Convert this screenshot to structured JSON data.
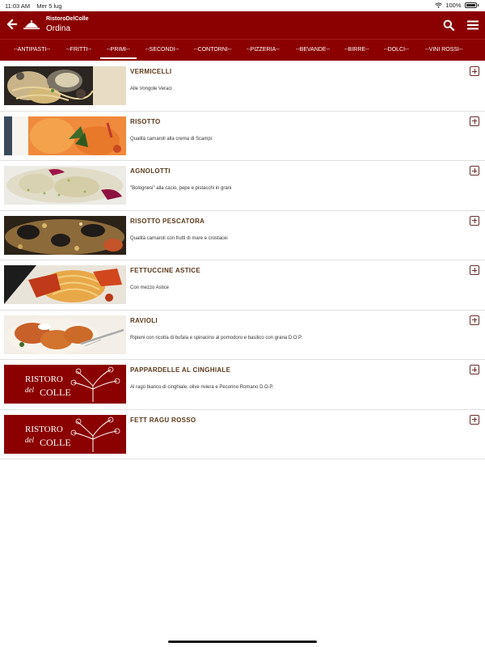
{
  "status": {
    "time": "11:03 AM",
    "date": "Mer 5 lug",
    "battery": "100%"
  },
  "header": {
    "brand": "RistoroDelColle",
    "title": "Ordina"
  },
  "tabs": [
    {
      "label": "--ANTIPASTI--"
    },
    {
      "label": "--FRITTI--"
    },
    {
      "label": "--PRIMI--"
    },
    {
      "label": "--SECONDI--"
    },
    {
      "label": "--CONTORNI--"
    },
    {
      "label": "--PIZZERIA--"
    },
    {
      "label": "--BEVANDE--"
    },
    {
      "label": "--BIRRE--"
    },
    {
      "label": "--DOLCI--"
    },
    {
      "label": "--VINI ROSSI--"
    }
  ],
  "active_tab": "--PRIMI--",
  "items": [
    {
      "name": "VERMICELLI",
      "description": "Alle Vongole Veraci",
      "image": "pasta-clams-photo"
    },
    {
      "name": "RISOTTO",
      "description": "Qualità carnaroli alla crema di Scampi",
      "image": "risotto-photo"
    },
    {
      "name": "AGNOLOTTI",
      "description": "\"Bolognesi\" alla cacio, pepe e pistacchi in grani",
      "image": "agnolotti-photo"
    },
    {
      "name": "RISOTTO PESCATORA",
      "description": "Qualità carnaroli con frutti di mare e crostacei",
      "image": "seafood-risotto-photo"
    },
    {
      "name": "FETTUCCINE ASTICE",
      "description": "Con mezzo Astice",
      "image": "lobster-pasta-photo"
    },
    {
      "name": "RAVIOLI",
      "description": "Ripieni con ricotta di bufala e spinacino al pomodoro e basilico con grana D.O.P.",
      "image": "ravioli-photo"
    },
    {
      "name": "PAPPARDELLE AL CINGHIALE",
      "description": "Al ragù bianco di cinghiale, olive riviera e Pecorino Romano D.O.P.",
      "image": "ristoro-logo"
    },
    {
      "name": "FETT RAGU ROSSO",
      "description": "",
      "image": "ristoro-logo"
    }
  ],
  "logo_text": {
    "line1": "RISTORO",
    "line2": "del",
    "line3": "COLLE"
  },
  "colors": {
    "brand": "#8b0000",
    "item_title": "#5a3a1a"
  }
}
